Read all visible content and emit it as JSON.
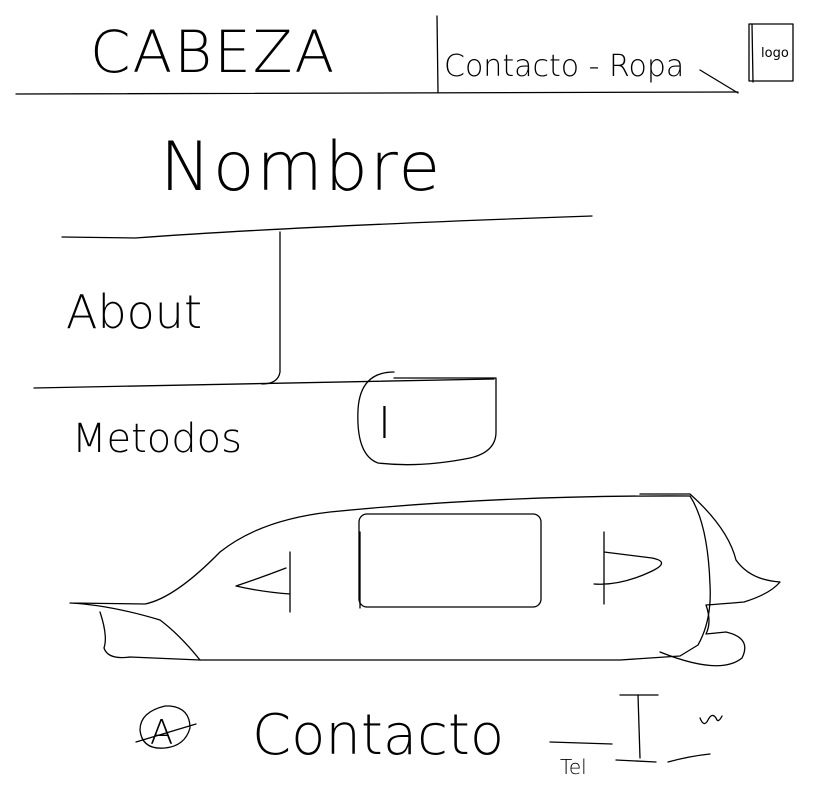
{
  "header": {
    "title": "CABEZA",
    "nav_text": "Contacto - Ropa",
    "logo_text": "logo"
  },
  "hero": {
    "name": "Nombre"
  },
  "sections": {
    "about": "About",
    "metodos": "Metodos",
    "metodos_icon_text": "I"
  },
  "carousel": {
    "prev_icon": "left-arrow-icon",
    "next_icon": "right-arrow-icon"
  },
  "footer": {
    "icon_text": "A",
    "contact": "Contacto",
    "small_text": "Tel",
    "icon2_text": "I",
    "icon3_text": "W"
  }
}
